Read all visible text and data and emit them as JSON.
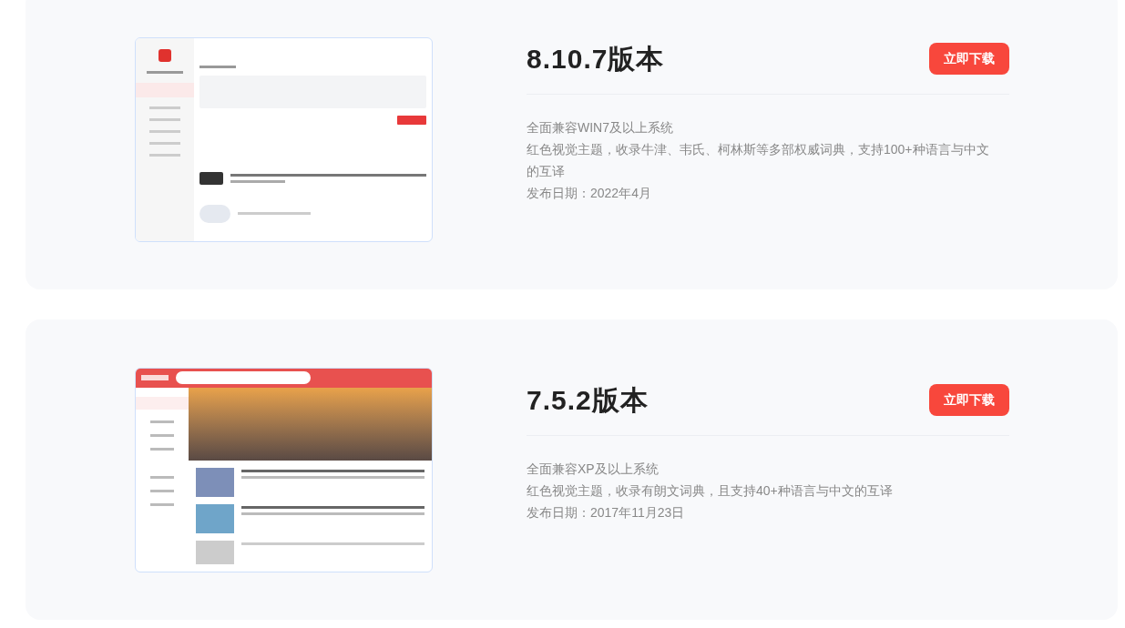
{
  "versions": [
    {
      "screenshot": {
        "kind": "light"
      },
      "title": "8.10.7版本",
      "button": "立即下载",
      "lines": [
        "全面兼容WIN7及以上系统",
        "红色视觉主题，收录牛津、韦氏、柯林斯等多部权威词典，支持100+种语言与中文的互译",
        "发布日期：2022年4月"
      ]
    },
    {
      "screenshot": {
        "kind": "red"
      },
      "title": "7.5.2版本",
      "button": "立即下载",
      "lines": [
        "全面兼容XP及以上系统",
        "红色视觉主题，收录有朗文词典，且支持40+种语言与中文的互译",
        "发布日期：2017年11月23日"
      ]
    }
  ]
}
